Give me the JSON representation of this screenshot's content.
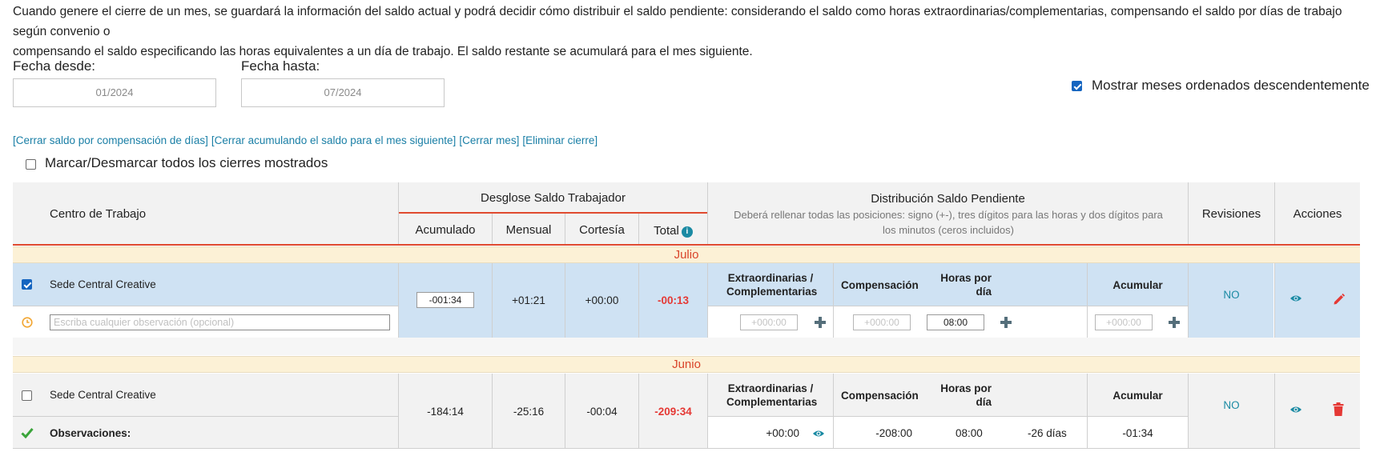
{
  "intro": {
    "line1": "Cuando genere el cierre de un mes, se guardará la información del saldo actual y podrá decidir cómo distribuir el saldo pendiente: considerando el saldo como horas extraordinarias/complementarias, compensando el saldo por días de trabajo según convenio o",
    "line2": "compensando el saldo especificando las horas equivalentes a un día de trabajo. El saldo restante se acumulará para el mes siguiente."
  },
  "filters": {
    "from_label": "Fecha desde:",
    "from_value": "01/2024",
    "to_label": "Fecha hasta:",
    "to_value": "07/2024",
    "sort_desc_label": "Mostrar meses ordenados descendentemente",
    "sort_desc_checked": true
  },
  "bulk_actions": {
    "close_compensation": "[Cerrar saldo por compensación de días]",
    "close_accumulate": "[Cerrar acumulando el saldo para el mes siguiente]",
    "close_month": "[Cerrar mes]",
    "delete_close": "[Eliminar cierre]",
    "toggle_all_label": "Marcar/Desmarcar todos los cierres mostrados"
  },
  "table": {
    "work_center_header": "Centro de Trabajo",
    "breakdown_header": "Desglose Saldo Trabajador",
    "breakdown_cols": [
      "Acumulado",
      "Mensual",
      "Cortesía",
      "Total"
    ],
    "distribution_header": "Distribución Saldo Pendiente",
    "distribution_note": "Deberá rellenar todas las posiciones: signo (+-), tres dígitos para las horas y dos dígitos para los minutos (ceros incluidos)",
    "reviews_header": "Revisiones",
    "actions_header": "Acciones",
    "dist_cols": {
      "extra": "Extraordinarias / Complementarias",
      "comp": "Compensación",
      "hours_per_day": "Horas por día",
      "accumulate": "Acumular"
    }
  },
  "months": [
    {
      "name": "Julio",
      "center": "Sede Central Creative",
      "checked": true,
      "accumulated": "-001:34",
      "monthly": "+01:21",
      "courtesy": "+00:00",
      "total": "-00:13",
      "observation_placeholder": "Escriba cualquier observación (opcional)",
      "extra_placeholder": "+000:00",
      "comp_placeholder": "+000:00",
      "hours_per_day": "08:00",
      "accumulate_placeholder": "+000:00",
      "reviews": "NO"
    },
    {
      "name": "Junio",
      "center": "Sede Central Creative",
      "checked": false,
      "accumulated": "-184:14",
      "monthly": "-25:16",
      "courtesy": "-00:04",
      "total": "-209:34",
      "observations_label": "Observaciones:",
      "extra": "+00:00",
      "comp": "-208:00",
      "hours_per_day": "08:00",
      "comp_days": "-26 días",
      "accumulate": "-01:34",
      "reviews": "NO"
    }
  ],
  "colors": {
    "accent": "#1a7fa6",
    "red": "#e53935",
    "row_blue": "#cfe2f3",
    "month_band": "#fcf1d6",
    "checkbox_blue": "#1565c0"
  },
  "icons": [
    "eye-icon",
    "pencil-icon",
    "trash-icon",
    "clock-icon",
    "check-icon",
    "plus-icon",
    "info-icon"
  ]
}
